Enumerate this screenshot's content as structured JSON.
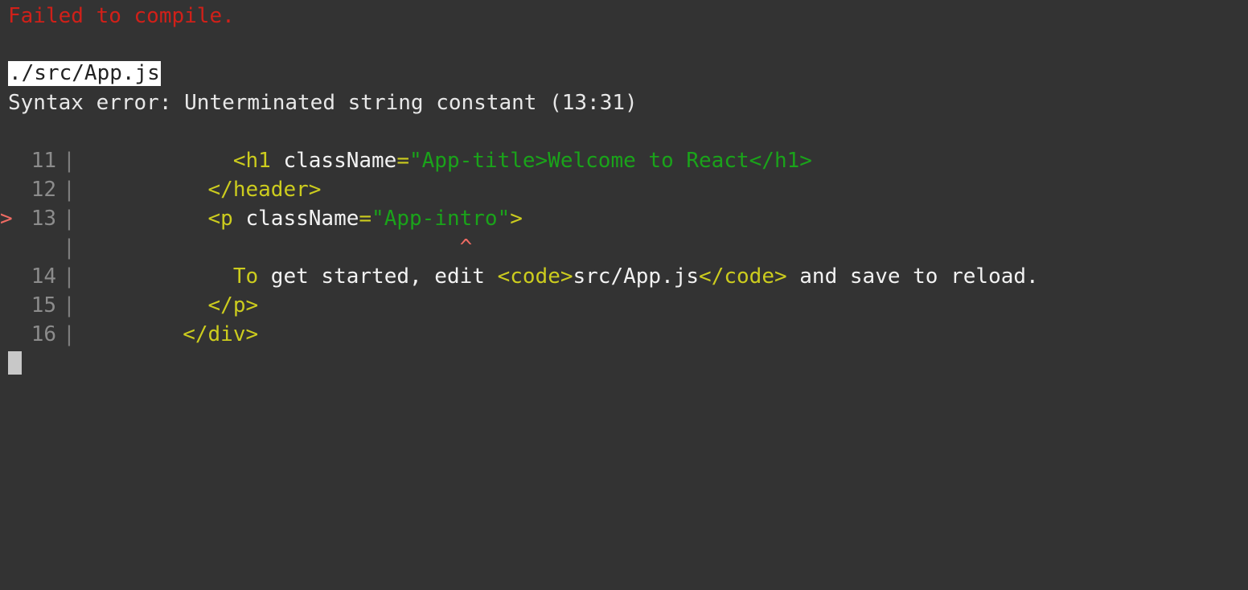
{
  "terminal": {
    "background_color": "#333333",
    "headline": "Failed to compile.",
    "headline_color": "#d02019",
    "file_path": "./src/App.js",
    "error_message": "Syntax error: Unterminated string constant (13:31)"
  },
  "code_frame": {
    "error_marker": ">",
    "gutter_separator": "|",
    "lines": [
      {
        "marker": "",
        "number": "11",
        "tokens": [
          {
            "text": "            <h1 ",
            "type": "tag"
          },
          {
            "text": "className",
            "type": "attr"
          },
          {
            "text": "=",
            "type": "eq"
          },
          {
            "text": "\"App-title>Welcome to React</h1>",
            "type": "str"
          }
        ]
      },
      {
        "marker": "",
        "number": "12",
        "tokens": [
          {
            "text": "          </header>",
            "type": "tag"
          }
        ]
      },
      {
        "marker": ">",
        "number": "13",
        "tokens": [
          {
            "text": "          <p ",
            "type": "tag"
          },
          {
            "text": "className",
            "type": "attr"
          },
          {
            "text": "=",
            "type": "eq"
          },
          {
            "text": "\"App-intro\"",
            "type": "str"
          },
          {
            "text": ">",
            "type": "tag"
          }
        ]
      },
      {
        "marker": "",
        "number": "",
        "tokens": [
          {
            "text": "                              ^",
            "type": "caret"
          }
        ]
      },
      {
        "marker": "",
        "number": "14",
        "tokens": [
          {
            "text": "            To",
            "type": "tag"
          },
          {
            "text": " get started, edit ",
            "type": "text"
          },
          {
            "text": "<code>",
            "type": "tag"
          },
          {
            "text": "src/App.js",
            "type": "text"
          },
          {
            "text": "</code>",
            "type": "tag"
          },
          {
            "text": " and save to reload.",
            "type": "text"
          }
        ]
      },
      {
        "marker": "",
        "number": "15",
        "tokens": [
          {
            "text": "          </p>",
            "type": "tag"
          }
        ]
      },
      {
        "marker": "",
        "number": "16",
        "tokens": [
          {
            "text": "        </div>",
            "type": "tag"
          }
        ]
      }
    ]
  },
  "cursor": {
    "color": "#c8c8c8",
    "visible": true
  },
  "token_colors": {
    "tag": "#cccc1e",
    "attribute": "#f2f2f2",
    "equals": "#cccc1e",
    "string": "#1aa31a",
    "text": "#f2f2f2",
    "caret": "#ef6b63",
    "line_number": "#8c8c8c",
    "gutter_bar": "#7d7d7d"
  }
}
